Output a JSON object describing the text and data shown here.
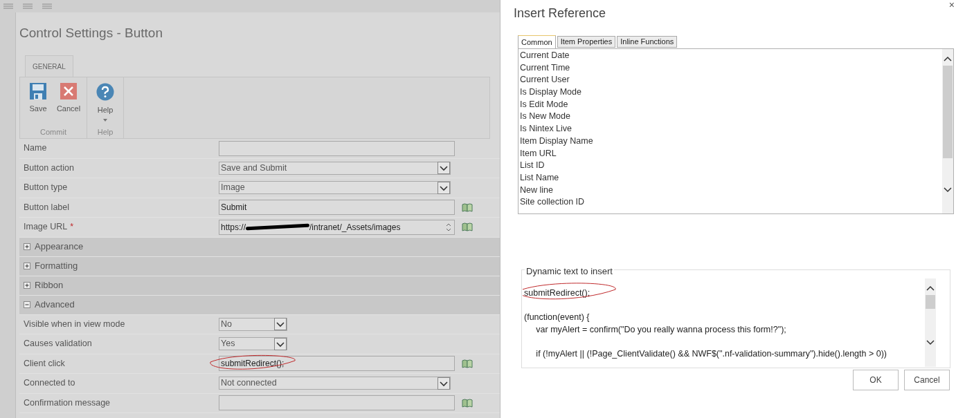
{
  "settings_dialog": {
    "title": "Control Settings - Button",
    "ribbon": {
      "tabs": [
        {
          "label": "GENERAL",
          "selected": true
        }
      ],
      "groups": [
        {
          "label": "Commit",
          "buttons": [
            {
              "kind": "save",
              "label": "Save"
            },
            {
              "kind": "cancel",
              "label": "Cancel"
            }
          ]
        },
        {
          "label": "Help",
          "buttons": [
            {
              "kind": "help",
              "label": "Help",
              "dropdown": true
            }
          ]
        }
      ]
    },
    "rows": [
      {
        "kind": "text",
        "label": "Name",
        "value": "",
        "reference": false
      },
      {
        "kind": "select",
        "label": "Button action",
        "value": "Save and Submit",
        "wide": true
      },
      {
        "kind": "select",
        "label": "Button type",
        "value": "Image",
        "wide": true
      },
      {
        "kind": "text",
        "label": "Button label",
        "value": "Submit",
        "reference": true
      },
      {
        "kind": "url",
        "label": "Image URL",
        "required_mark": "*",
        "value_start": "https://",
        "value_end": "/intranet/_Assets/images",
        "reference": true
      },
      {
        "kind": "section",
        "label": "Appearance",
        "expanded": false
      },
      {
        "kind": "section",
        "label": "Formatting",
        "expanded": false
      },
      {
        "kind": "section",
        "label": "Ribbon",
        "expanded": false
      },
      {
        "kind": "section",
        "label": "Advanced",
        "expanded": true
      },
      {
        "kind": "select",
        "label": "Visible when in view mode",
        "value": "No",
        "wide": false
      },
      {
        "kind": "select",
        "label": "Causes validation",
        "value": "Yes",
        "wide": false
      },
      {
        "kind": "text",
        "label": "Client click",
        "value": "submitRedirect();",
        "reference": true,
        "circled": true
      },
      {
        "kind": "select",
        "label": "Connected to",
        "value": "Not connected",
        "wide": true
      },
      {
        "kind": "text",
        "label": "Confirmation message",
        "value": "",
        "reference": true
      }
    ]
  },
  "reference_dialog": {
    "title": "Insert Reference",
    "close": "×",
    "tabs": [
      {
        "label": "Common",
        "selected": true
      },
      {
        "label": "Item Properties",
        "selected": false
      },
      {
        "label": "Inline Functions",
        "selected": false
      }
    ],
    "items": [
      "Current Date",
      "Current Time",
      "Current User",
      "Is Display Mode",
      "Is Edit Mode",
      "Is New Mode",
      "Is Nintex Live",
      "Item Display Name",
      "Item URL",
      "List ID",
      "List Name",
      "New line",
      "Site collection ID"
    ],
    "dynamic_text": {
      "legend": "Dynamic text to insert",
      "lines": [
        {
          "text": "submitRedirect();",
          "circled": true
        },
        {
          "kind": "blank"
        },
        {
          "text": "(function(event) {"
        },
        {
          "text": "     var myAlert = confirm(\"Do you really wanna process this form!?\");"
        },
        {
          "kind": "blank"
        },
        {
          "text": "     if (!myAlert || (!Page_ClientValidate() && NWF$(\".nf-validation-summary\").hide().length > 0))"
        }
      ]
    },
    "buttons": [
      "OK",
      "Cancel"
    ]
  }
}
